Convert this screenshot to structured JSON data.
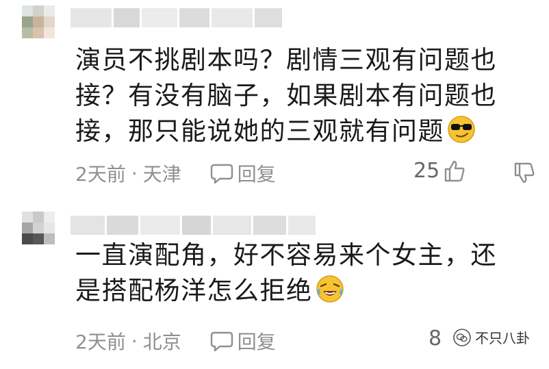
{
  "comments": [
    {
      "text": "演员不挑剧本吗？剧情三观有问题也\n接？有没有脑子，如果剧本有问题也\n接，那只能说她的三观就有问题",
      "emoji": "sunglasses-emoji",
      "time": "2天前",
      "location": "天津",
      "reply_label": "回复",
      "likes": "25"
    },
    {
      "text": "一直演配角，好不容易来个女主，还\n是搭配杨洋怎么拒绝",
      "emoji": "laughing-crying-emoji",
      "time": "2天前",
      "location": "北京",
      "reply_label": "回复",
      "likes": "8"
    }
  ],
  "separator": "·",
  "watermark": "不只八卦",
  "colors": {
    "text": "#1a1a1a",
    "meta": "#8f8f8f"
  }
}
